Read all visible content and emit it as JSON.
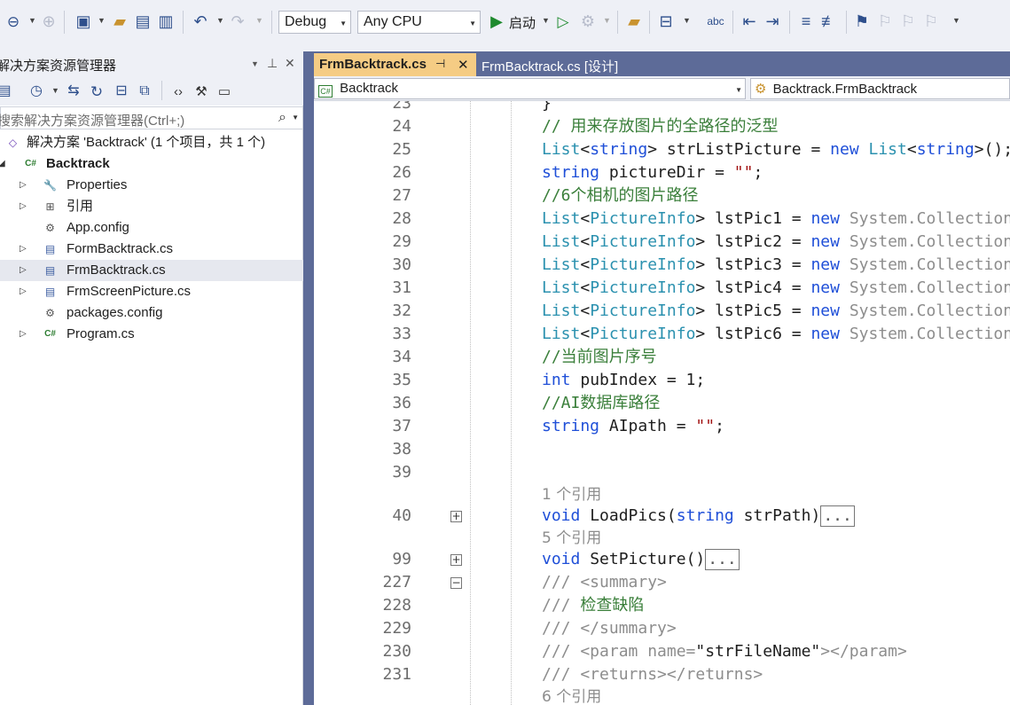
{
  "toolbar": {
    "config": "Debug",
    "platform": "Any CPU",
    "start_label": "启动",
    "icons": [
      "back-icon",
      "forward-icon",
      "new-project-icon",
      "open-icon",
      "save-icon",
      "save-all-icon",
      "undo-icon",
      "redo-icon",
      "start-icon",
      "start-without-debug-icon",
      "browse-icon",
      "find-icon",
      "layout-icon",
      "spell-icon",
      "indent-icon",
      "comment-icon",
      "bookmark-icon"
    ]
  },
  "solution_explorer": {
    "title": "解决方案资源管理器",
    "search_placeholder": "搜索解决方案资源管理器(Ctrl+;)",
    "items": [
      {
        "label": "解决方案 'Backtrack' (1 个项目，共 1 个)",
        "icon": "solution-icon",
        "level": 0,
        "expander": "",
        "bold": false
      },
      {
        "label": "Backtrack",
        "icon": "csharp-project-icon",
        "level": 0,
        "expander": "▲",
        "bold": true
      },
      {
        "label": "Properties",
        "icon": "wrench-icon",
        "level": 1,
        "expander": "▷",
        "bold": false
      },
      {
        "label": "引用",
        "icon": "references-icon",
        "level": 1,
        "expander": "▷",
        "bold": false
      },
      {
        "label": "App.config",
        "icon": "config-icon",
        "level": 1,
        "expander": "",
        "bold": false
      },
      {
        "label": "FormBacktrack.cs",
        "icon": "form-icon",
        "level": 1,
        "expander": "▷",
        "bold": false
      },
      {
        "label": "FrmBacktrack.cs",
        "icon": "form-icon",
        "level": 1,
        "expander": "▷",
        "bold": false,
        "selected": true
      },
      {
        "label": "FrmScreenPicture.cs",
        "icon": "form-icon",
        "level": 1,
        "expander": "▷",
        "bold": false
      },
      {
        "label": "packages.config",
        "icon": "config-icon",
        "level": 1,
        "expander": "",
        "bold": false
      },
      {
        "label": "Program.cs",
        "icon": "csharp-file-icon",
        "level": 1,
        "expander": "▷",
        "bold": false
      }
    ]
  },
  "editor": {
    "tabs": [
      {
        "label": "FrmBacktrack.cs",
        "active": true
      },
      {
        "label": "FrmBacktrack.cs [设计]",
        "active": false
      }
    ],
    "nav_left": "Backtrack",
    "nav_right": "Backtrack.FrmBacktrack",
    "lines": [
      {
        "n": "23",
        "parts": [
          [
            "df",
            "}"
          ]
        ]
      },
      {
        "n": "24",
        "parts": [
          [
            "cm",
            "// 用来存放图片的全路径的泛型"
          ]
        ]
      },
      {
        "n": "25",
        "parts": [
          [
            "ty",
            "List"
          ],
          [
            "df",
            "<"
          ],
          [
            "kw",
            "string"
          ],
          [
            "df",
            "> strListPicture = "
          ],
          [
            "kw",
            "new "
          ],
          [
            "ty",
            "List"
          ],
          [
            "df",
            "<"
          ],
          [
            "kw",
            "string"
          ],
          [
            "df",
            ">();"
          ]
        ]
      },
      {
        "n": "26",
        "parts": [
          [
            "kw",
            "string"
          ],
          [
            "df",
            " pictureDir = "
          ],
          [
            "st",
            "\"\""
          ],
          [
            "df",
            ";"
          ]
        ]
      },
      {
        "n": "27",
        "parts": [
          [
            "cm",
            "//6个相机的图片路径"
          ]
        ]
      },
      {
        "n": "28",
        "parts": [
          [
            "ty",
            "List"
          ],
          [
            "df",
            "<"
          ],
          [
            "ty",
            "PictureInfo"
          ],
          [
            "df",
            "> lstPic1 = "
          ],
          [
            "kw",
            "new "
          ],
          [
            "gr",
            "System.Collections"
          ]
        ]
      },
      {
        "n": "29",
        "parts": [
          [
            "ty",
            "List"
          ],
          [
            "df",
            "<"
          ],
          [
            "ty",
            "PictureInfo"
          ],
          [
            "df",
            "> lstPic2 = "
          ],
          [
            "kw",
            "new "
          ],
          [
            "gr",
            "System.Collections"
          ]
        ]
      },
      {
        "n": "30",
        "parts": [
          [
            "ty",
            "List"
          ],
          [
            "df",
            "<"
          ],
          [
            "ty",
            "PictureInfo"
          ],
          [
            "df",
            "> lstPic3 = "
          ],
          [
            "kw",
            "new "
          ],
          [
            "gr",
            "System.Collections"
          ]
        ]
      },
      {
        "n": "31",
        "parts": [
          [
            "ty",
            "List"
          ],
          [
            "df",
            "<"
          ],
          [
            "ty",
            "PictureInfo"
          ],
          [
            "df",
            "> lstPic4 = "
          ],
          [
            "kw",
            "new "
          ],
          [
            "gr",
            "System.Collections"
          ]
        ]
      },
      {
        "n": "32",
        "parts": [
          [
            "ty",
            "List"
          ],
          [
            "df",
            "<"
          ],
          [
            "ty",
            "PictureInfo"
          ],
          [
            "df",
            "> lstPic5 = "
          ],
          [
            "kw",
            "new "
          ],
          [
            "gr",
            "System.Collections"
          ]
        ]
      },
      {
        "n": "33",
        "parts": [
          [
            "ty",
            "List"
          ],
          [
            "df",
            "<"
          ],
          [
            "ty",
            "PictureInfo"
          ],
          [
            "df",
            "> lstPic6 = "
          ],
          [
            "kw",
            "new "
          ],
          [
            "gr",
            "System.Collections"
          ]
        ]
      },
      {
        "n": "34",
        "parts": [
          [
            "cm",
            "//当前图片序号"
          ]
        ]
      },
      {
        "n": "35",
        "parts": [
          [
            "kw",
            "int"
          ],
          [
            "df",
            " pubIndex = 1;"
          ]
        ]
      },
      {
        "n": "36",
        "parts": [
          [
            "cm",
            "//AI数据库路径"
          ]
        ]
      },
      {
        "n": "37",
        "parts": [
          [
            "kw",
            "string"
          ],
          [
            "df",
            " AIpath = "
          ],
          [
            "st",
            "\"\""
          ],
          [
            "df",
            ";"
          ]
        ]
      },
      {
        "n": "38",
        "parts": []
      },
      {
        "n": "39",
        "parts": []
      },
      {
        "n": "",
        "ref": "1 个引用",
        "parts": []
      },
      {
        "n": "40",
        "fold": "+",
        "parts": [
          [
            "kw",
            "void"
          ],
          [
            "df",
            " LoadPics("
          ],
          [
            "kw",
            "string"
          ],
          [
            "df",
            " strPath)"
          ]
        ],
        "collapsed": "..."
      },
      {
        "n": "",
        "ref": "5 个引用",
        "parts": []
      },
      {
        "n": "99",
        "fold": "+",
        "parts": [
          [
            "kw",
            "void"
          ],
          [
            "df",
            " SetPicture()"
          ]
        ],
        "collapsed": "..."
      },
      {
        "n": "227",
        "fold": "-",
        "parts": [
          [
            "gr",
            "/// <summary>"
          ]
        ]
      },
      {
        "n": "228",
        "parts": [
          [
            "gr",
            "/// "
          ],
          [
            "cm",
            "检查缺陷"
          ]
        ]
      },
      {
        "n": "229",
        "parts": [
          [
            "gr",
            "/// </summary>"
          ]
        ]
      },
      {
        "n": "230",
        "parts": [
          [
            "gr",
            "/// <param name="
          ],
          [
            "df",
            "\"strFileName\""
          ],
          [
            "gr",
            "></param>"
          ]
        ]
      },
      {
        "n": "231",
        "parts": [
          [
            "gr",
            "/// <returns></returns>"
          ]
        ]
      },
      {
        "n": "",
        "ref": "6 个引用",
        "parts": []
      }
    ]
  },
  "colors": {
    "keyword": "#1f4fd8",
    "type": "#2b91af",
    "comment": "#3a7f3a",
    "string": "#a31515",
    "active_tab": "#f5cc84",
    "tab_strip": "#5d6b98"
  }
}
